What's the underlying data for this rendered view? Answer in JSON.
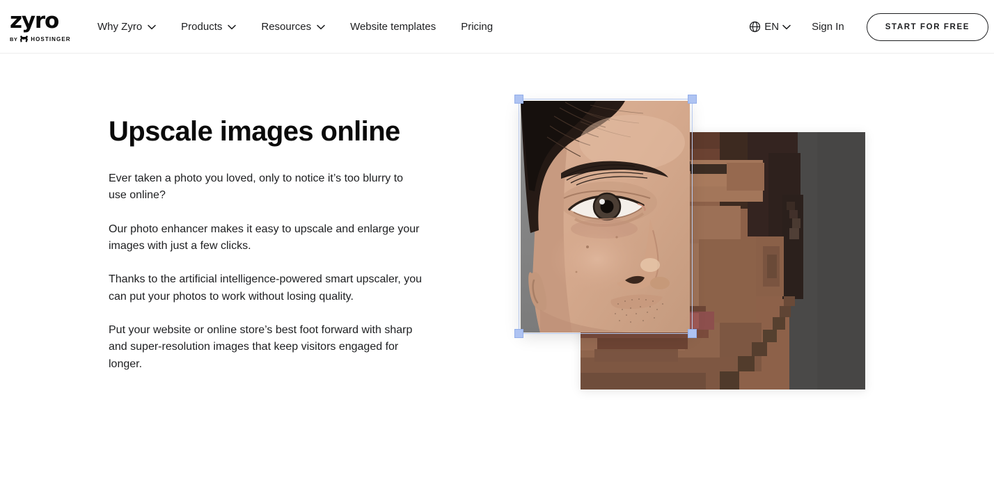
{
  "header": {
    "logo": {
      "wordmark": "zyro",
      "by_label": "BY",
      "parent_brand": "HOSTINGER",
      "icon": "hostinger-horse-icon"
    },
    "nav": [
      {
        "label": "Why Zyro",
        "has_dropdown": true,
        "icon": "chevron-down-icon"
      },
      {
        "label": "Products",
        "has_dropdown": true,
        "icon": "chevron-down-icon"
      },
      {
        "label": "Resources",
        "has_dropdown": true,
        "icon": "chevron-down-icon"
      },
      {
        "label": "Website templates",
        "has_dropdown": false
      },
      {
        "label": "Pricing",
        "has_dropdown": false
      }
    ],
    "language": {
      "icon": "globe-icon",
      "value": "EN",
      "chevron": "chevron-down-icon"
    },
    "sign_in_label": "Sign In",
    "cta_label": "START FOR FREE"
  },
  "hero": {
    "title": "Upscale images online",
    "paragraphs": [
      "Ever taken a photo you loved, only to notice it’s too blurry to use online?",
      "Our photo enhancer makes it easy to upscale and enlarge your images with just a few clicks.",
      "Thanks to the artificial intelligence-powered smart upscaler, you can put your photos to work without losing quality.",
      "Put your website or online store’s best foot forward with sharp and super-resolution images that keep visitors engaged for longer."
    ],
    "media": {
      "sharp_image_alt": "upscaled-sharp-portrait",
      "pixelated_image_alt": "low-resolution-pixelated-portrait",
      "selection": {
        "name": "image-selection-box",
        "handles": [
          "top-left",
          "top-right",
          "bottom-left",
          "bottom-right"
        ]
      }
    }
  },
  "colors": {
    "page_background": "#ffffff",
    "text_primary": "#1d1e20",
    "heading": "#0a0a0a",
    "header_border": "#ececec",
    "selection_handle": "#aec3f2",
    "selection_border": "#b9cbf0",
    "portrait_backdrop": "#4a4a4a"
  }
}
